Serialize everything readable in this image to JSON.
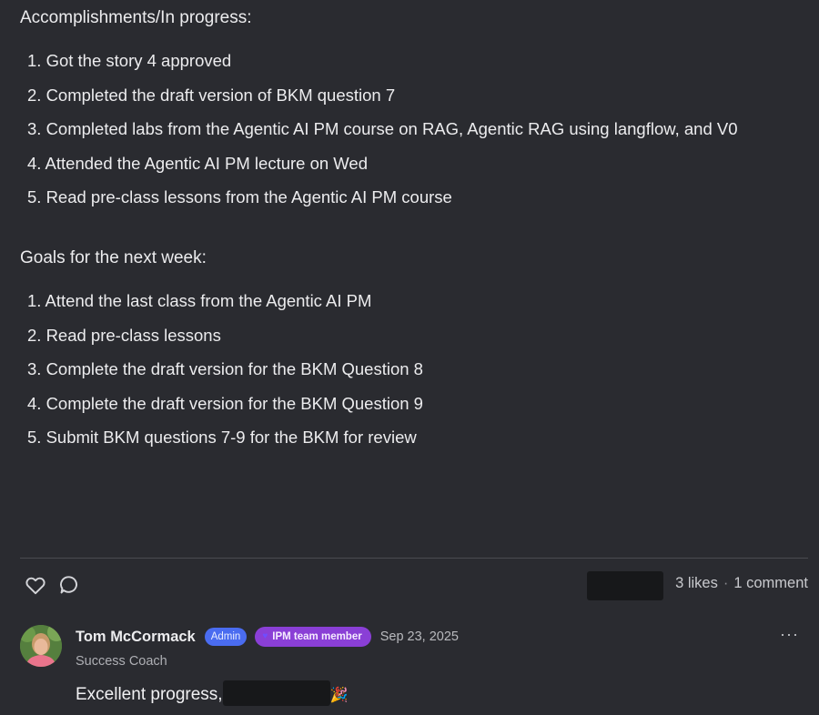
{
  "post": {
    "accomplishments_heading": "Accomplishments/In progress:",
    "accomplishments": [
      "1. Got the story 4 approved",
      "2. Completed the draft version of BKM question 7",
      "3. Completed labs from the Agentic AI PM course on RAG, Agentic RAG using langflow, and V0",
      "4. Attended the Agentic AI PM lecture on Wed",
      "5. Read pre-class lessons from the Agentic AI PM course"
    ],
    "goals_heading": "Goals for the next week:",
    "goals": [
      "1. Attend the last class from the Agentic AI PM",
      "2. Read pre-class lessons",
      "3. Complete the draft version for the BKM Question 8",
      "4. Complete the draft version for the BKM Question 9",
      "5. Submit BKM questions 7-9 for the BKM for review"
    ]
  },
  "actions": {
    "like_icon": "heart-outline-icon",
    "comment_icon": "speech-bubble-icon",
    "likes": "3 likes",
    "separator": "·",
    "comments": "1 comment"
  },
  "comment": {
    "author": "Tom McCormack",
    "admin_badge": "Admin",
    "team_badge": "IPM team member",
    "date": "Sep 23, 2025",
    "subtitle": "Success Coach",
    "text": "Excellent progress,",
    "emoji": "🎉",
    "more": "···"
  },
  "colors": {
    "background": "#2a2b30",
    "admin_badge": "#4a6cf0",
    "team_badge": "#8a3fd6",
    "redaction": "#17181a"
  }
}
